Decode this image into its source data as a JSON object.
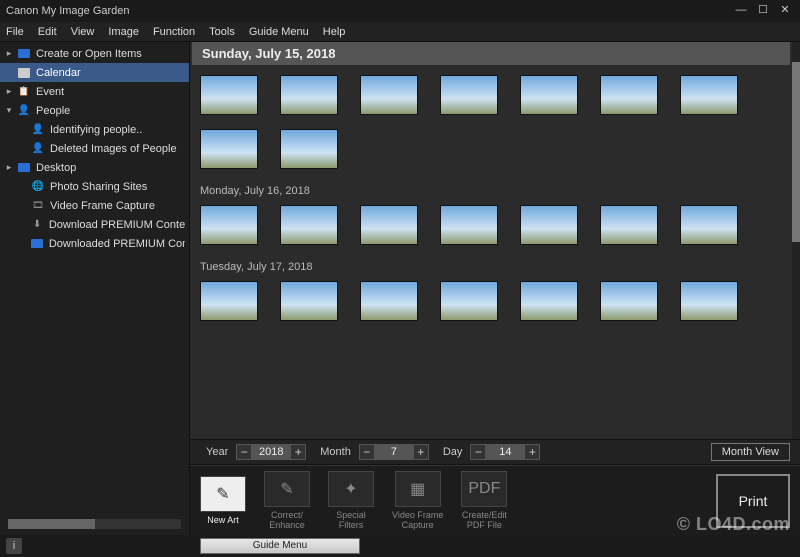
{
  "title": "Canon My Image Garden",
  "win_controls": {
    "min": "—",
    "max": "☐",
    "close": "✕"
  },
  "menu": [
    "File",
    "Edit",
    "View",
    "Image",
    "Function",
    "Tools",
    "Guide Menu",
    "Help"
  ],
  "sidebar": {
    "items": [
      {
        "arrow": "▸",
        "iconClass": "folder",
        "label": "Create or Open Items",
        "selected": false,
        "indent": 0
      },
      {
        "arrow": "",
        "iconClass": "calendar",
        "label": "Calendar",
        "selected": true,
        "indent": 0
      },
      {
        "arrow": "▸",
        "iconClass": "event",
        "label": "Event",
        "selected": false,
        "indent": 0
      },
      {
        "arrow": "▾",
        "iconClass": "people",
        "label": "People",
        "selected": false,
        "indent": 0
      },
      {
        "arrow": "",
        "iconClass": "people",
        "label": "Identifying people..",
        "selected": false,
        "indent": 1
      },
      {
        "arrow": "",
        "iconClass": "people",
        "label": "Deleted Images of People",
        "selected": false,
        "indent": 1
      },
      {
        "arrow": "▸",
        "iconClass": "folder",
        "label": "Desktop",
        "selected": false,
        "indent": 0
      },
      {
        "arrow": "",
        "iconClass": "globe",
        "label": "Photo Sharing Sites",
        "selected": false,
        "indent": 1
      },
      {
        "arrow": "",
        "iconClass": "film",
        "label": "Video Frame Capture",
        "selected": false,
        "indent": 1
      },
      {
        "arrow": "",
        "iconClass": "dl",
        "label": "Download PREMIUM Conten",
        "selected": false,
        "indent": 1
      },
      {
        "arrow": "",
        "iconClass": "folder",
        "label": "Downloaded PREMIUM Cont",
        "selected": false,
        "indent": 1
      }
    ]
  },
  "dates": {
    "header": "Sunday, July 15, 2018",
    "row1_count": 7,
    "row2_count": 2,
    "sub1": "Monday, July 16, 2018",
    "row3_count": 7,
    "sub2": "Tuesday, July 17, 2018",
    "row4_count": 7
  },
  "datebar": {
    "year_label": "Year",
    "year_value": "2018",
    "month_label": "Month",
    "month_value": "7",
    "day_label": "Day",
    "day_value": "14",
    "minus": "−",
    "plus": "+",
    "month_view": "Month View"
  },
  "tools": [
    {
      "icon": "✎",
      "label": "New Art",
      "active": true
    },
    {
      "icon": "✎",
      "label": "Correct/\nEnhance",
      "active": false
    },
    {
      "icon": "✦",
      "label": "Special\nFilters",
      "active": false
    },
    {
      "icon": "▦",
      "label": "Video Frame\nCapture",
      "active": false
    },
    {
      "icon": "PDF",
      "label": "Create/Edit\nPDF File",
      "active": false
    }
  ],
  "print_label": "Print",
  "status": {
    "info": "i",
    "guide": "Guide Menu"
  },
  "watermark": "© LO4D.com"
}
